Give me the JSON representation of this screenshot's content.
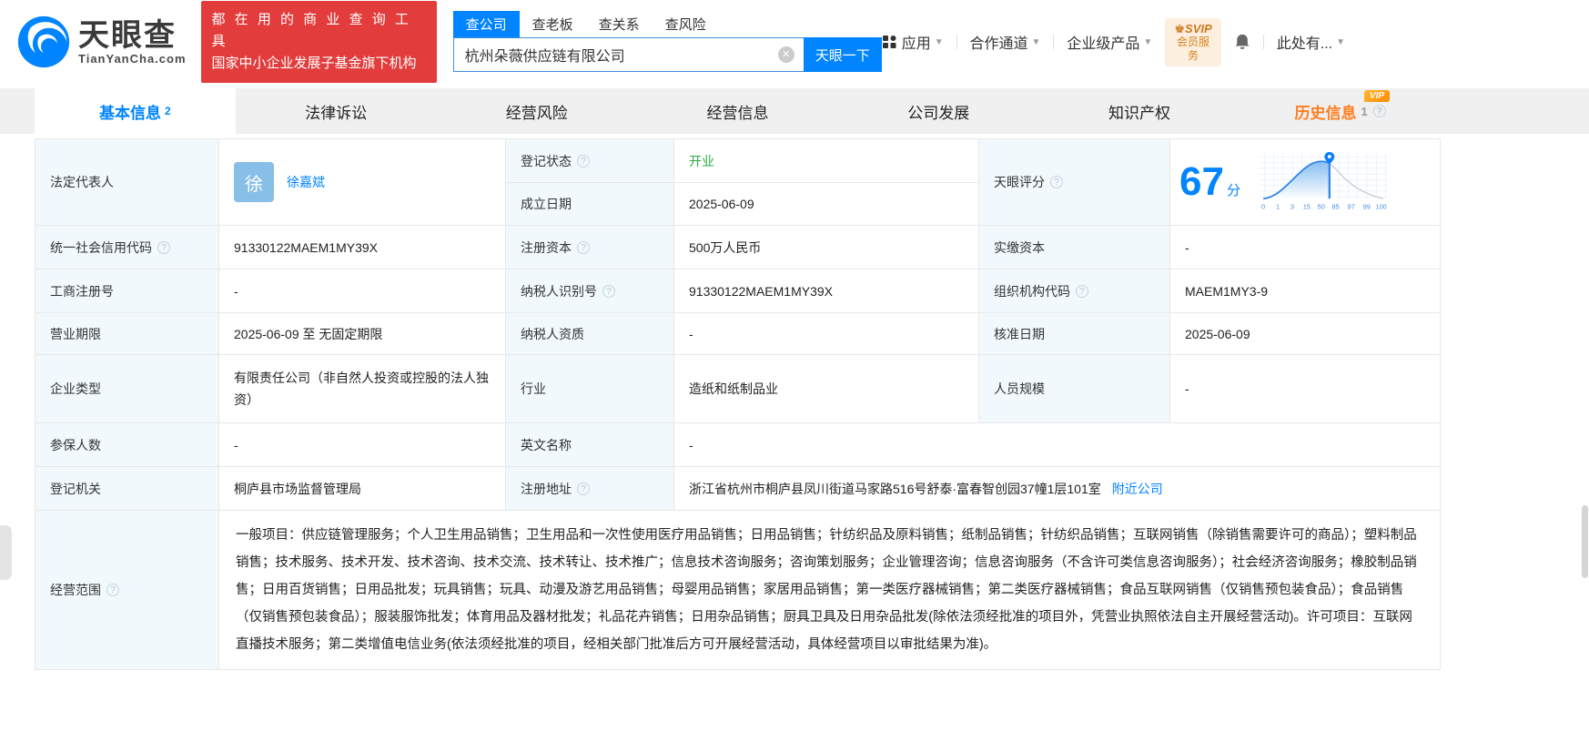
{
  "brand": {
    "logo_title": "天眼查",
    "logo_subtitle": "TianYanCha.com",
    "promo_line1": "都 在 用 的 商 业 查 询 工 具",
    "promo_line2": "国家中小企业发展子基金旗下机构"
  },
  "search": {
    "tabs": [
      {
        "label": "查公司"
      },
      {
        "label": "查老板"
      },
      {
        "label": "查关系"
      },
      {
        "label": "查风险"
      }
    ],
    "input_value": "杭州朵薇供应链有限公司",
    "button_label": "天眼一下"
  },
  "top_nav": {
    "apps": "应用",
    "cooperation": "合作通道",
    "enterprise": "企业级产品",
    "svip_line1": "SVIP",
    "svip_line2": "会员服务",
    "more": "此处有..."
  },
  "page_tabs": {
    "basic": {
      "label": "基本信息",
      "count": "2"
    },
    "lawsuit": {
      "label": "法律诉讼"
    },
    "risk": {
      "label": "经营风险"
    },
    "operation": {
      "label": "经营信息"
    },
    "development": {
      "label": "公司发展"
    },
    "ip": {
      "label": "知识产权"
    },
    "history": {
      "label": "历史信息",
      "count": "1",
      "vip": "VIP"
    }
  },
  "colors": {
    "brand_blue": "#0084ff",
    "status_green": "#2eaa47",
    "history_orange": "#ff7e21",
    "promo_red": "#e23c3c",
    "label_bg": "#f1f9fd"
  },
  "info": {
    "legal_rep": {
      "label": "法定代表人",
      "avatar_char": "徐",
      "name": "徐嘉斌"
    },
    "reg_status": {
      "label": "登记状态",
      "value": "开业"
    },
    "est_date": {
      "label": "成立日期",
      "value": "2025-06-09"
    },
    "score": {
      "label": "天眼评分",
      "value": "67",
      "unit": "分",
      "axis": [
        "0",
        "1",
        "3",
        "15",
        "50",
        "85",
        "97",
        "99",
        "100"
      ]
    },
    "credit_code": {
      "label": "统一社会信用代码",
      "value": "91330122MAEM1MY39X"
    },
    "reg_capital": {
      "label": "注册资本",
      "value": "500万人民币"
    },
    "paid_capital": {
      "label": "实缴资本",
      "value": "-"
    },
    "reg_number": {
      "label": "工商注册号",
      "value": "-"
    },
    "taxpayer_id": {
      "label": "纳税人识别号",
      "value": "91330122MAEM1MY39X"
    },
    "org_code": {
      "label": "组织机构代码",
      "value": "MAEM1MY3-9"
    },
    "business_term": {
      "label": "营业期限",
      "value": "2025-06-09 至 无固定期限"
    },
    "taxpayer_quals": {
      "label": "纳税人资质",
      "value": "-"
    },
    "approval_date": {
      "label": "核准日期",
      "value": "2025-06-09"
    },
    "company_type": {
      "label": "企业类型",
      "value": "有限责任公司（非自然人投资或控股的法人独资）"
    },
    "industry": {
      "label": "行业",
      "value": "造纸和纸制品业"
    },
    "staff_size": {
      "label": "人员规模",
      "value": "-"
    },
    "insured_count": {
      "label": "参保人数",
      "value": "-"
    },
    "english_name": {
      "label": "英文名称",
      "value": "-"
    },
    "reg_authority": {
      "label": "登记机关",
      "value": "桐庐县市场监督管理局"
    },
    "reg_address": {
      "label": "注册地址",
      "value": "浙江省杭州市桐庐县凤川街道马家路516号舒泰·富春智创园37幢1层101室",
      "nearby_link": "附近公司"
    },
    "business_scope": {
      "label": "经营范围",
      "value": "一般项目：供应链管理服务；个人卫生用品销售；卫生用品和一次性使用医疗用品销售；日用品销售；针纺织品及原料销售；纸制品销售；针纺织品销售；互联网销售（除销售需要许可的商品）；塑料制品销售；技术服务、技术开发、技术咨询、技术交流、技术转让、技术推广；信息技术咨询服务；咨询策划服务；企业管理咨询；信息咨询服务（不含许可类信息咨询服务）；社会经济咨询服务；橡胶制品销售；日用百货销售；日用品批发；玩具销售；玩具、动漫及游艺用品销售；母婴用品销售；家居用品销售；第一类医疗器械销售；第二类医疗器械销售；食品互联网销售（仅销售预包装食品）；食品销售（仅销售预包装食品）；服装服饰批发；体育用品及器材批发；礼品花卉销售；日用杂品销售；厨具卫具及日用杂品批发(除依法须经批准的项目外，凭营业执照依法自主开展经营活动)。许可项目：互联网直播技术服务；第二类增值电信业务(依法须经批准的项目，经相关部门批准后方可开展经营活动，具体经营项目以审批结果为准)。"
    }
  }
}
